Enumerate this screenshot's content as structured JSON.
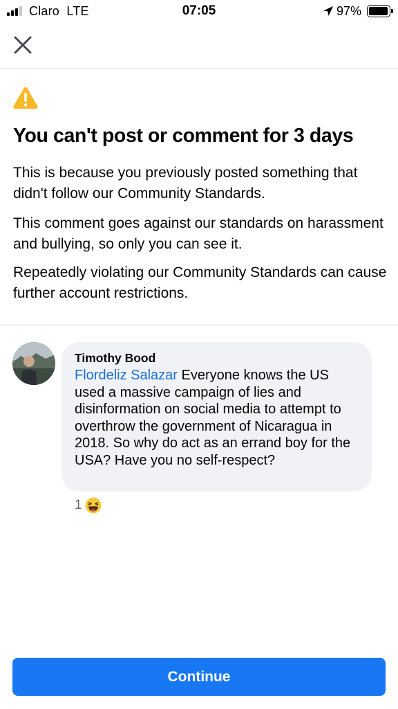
{
  "status_bar": {
    "carrier": "Claro",
    "network": "LTE",
    "time": "07:05",
    "battery": "97%",
    "battery_level": 0.97,
    "icons": [
      "signal-bars-icon",
      "location-arrow-icon",
      "battery-icon"
    ]
  },
  "header": {
    "close_icon": "close-icon"
  },
  "notice": {
    "icon": "warning-icon",
    "title": "You can't post or comment for 3 days",
    "paragraphs": [
      "This is because you previously posted something that didn't follow our Community Standards.",
      "This comment goes against our standards on harassment and bullying, so only you can see it.",
      "Repeatedly violating our Community Standards can cause further account restrictions."
    ]
  },
  "comment": {
    "author": "Timothy Bood",
    "mention": "Flordeliz Salazar",
    "text": " Everyone knows the US used a massive campaign of lies and disinformation on social media to attempt to overthrow the government of Nicaragua in 2018. So why do act as an errand boy for the USA? Have you no self-respect?",
    "reaction_count": "1",
    "reaction_icon": "haha-emoji-icon"
  },
  "footer": {
    "continue_label": "Continue"
  },
  "colors": {
    "primary": "#1877f2",
    "mention": "#1a6ed8",
    "bubble": "#f0f2f5",
    "warning": "#f7b928"
  }
}
